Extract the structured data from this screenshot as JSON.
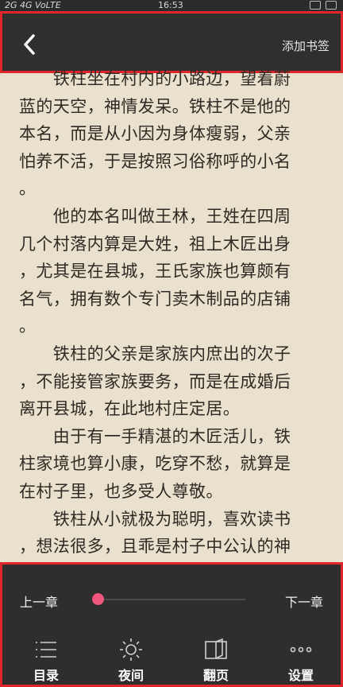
{
  "status_bar": {
    "network": "2G 4G VoLTE",
    "time": "16:53"
  },
  "top_bar": {
    "bookmark_label": "添加书签"
  },
  "content": {
    "lines": [
      "　　铁柱坐在村内的小路边，望着蔚",
      "蓝的天空，神情发呆。铁柱不是他的",
      "本名，而是从小因为身体瘦弱，父亲",
      "怕养不活，于是按照习俗称呼的小名",
      "。",
      "　　他的本名叫做王林，王姓在四周",
      "几个村落内算是大姓，祖上木匠出身",
      "，尤其是在县城，王氏家族也算颇有",
      "名气，拥有数个专门卖木制品的店铺",
      "。",
      "　　铁柱的父亲是家族内庶出的次子",
      "，不能接管家族要务，而是在成婚后",
      "离开县城，在此地村庄定居。",
      "　　由于有一手精湛的木匠活儿，铁",
      "柱家境也算小康，吃穿不愁，就算是",
      "在村子里，也多受人尊敬。",
      "　　铁柱从小就极为聪明，喜欢读书",
      "，想法很多，且乖是村子中公认的神"
    ]
  },
  "bottom_bar": {
    "prev_chapter": "上一章",
    "next_chapter": "下一章",
    "progress": 0.0,
    "accent_color": "#f0577e",
    "tabs": [
      {
        "label": "目录",
        "icon": "catalog-icon"
      },
      {
        "label": "夜间",
        "icon": "sun-icon"
      },
      {
        "label": "翻页",
        "icon": "book-icon"
      },
      {
        "label": "设置",
        "icon": "more-icon"
      }
    ]
  }
}
